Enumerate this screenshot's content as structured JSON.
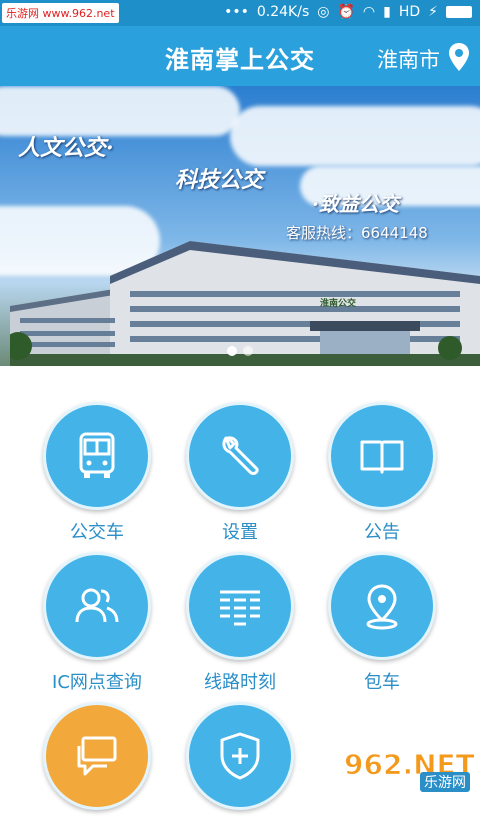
{
  "status_bar": {
    "watermark": "乐游网 www.962.net",
    "speed": "0.24K/s",
    "network": "HD"
  },
  "header": {
    "title": "淮南掌上公交",
    "city": "淮南市"
  },
  "banner": {
    "slogan_1": "人文公交·",
    "slogan_2": "科技公交",
    "slogan_3": "·致益公交",
    "hotline": "客服热线：6644148",
    "building_sign": "淮南公交",
    "active_slide": 1,
    "slide_count": 2
  },
  "menu": [
    {
      "label": "公交车",
      "icon": "bus-icon"
    },
    {
      "label": "设置",
      "icon": "wrench-icon"
    },
    {
      "label": "公告",
      "icon": "book-icon"
    },
    {
      "label": "IC网点查询",
      "icon": "users-icon"
    },
    {
      "label": "线路时刻",
      "icon": "timetable-icon"
    },
    {
      "label": "包车",
      "icon": "location-pin-icon"
    },
    {
      "label": "",
      "icon": "chat-icon",
      "color": "#f2a83a"
    },
    {
      "label": "",
      "icon": "shield-plus-icon"
    }
  ],
  "footer_watermark": {
    "logo": "962.NET",
    "text": "乐游网"
  },
  "colors": {
    "primary": "#2aa0dc",
    "tile": "#43b3e8",
    "accent": "#f2a83a"
  }
}
